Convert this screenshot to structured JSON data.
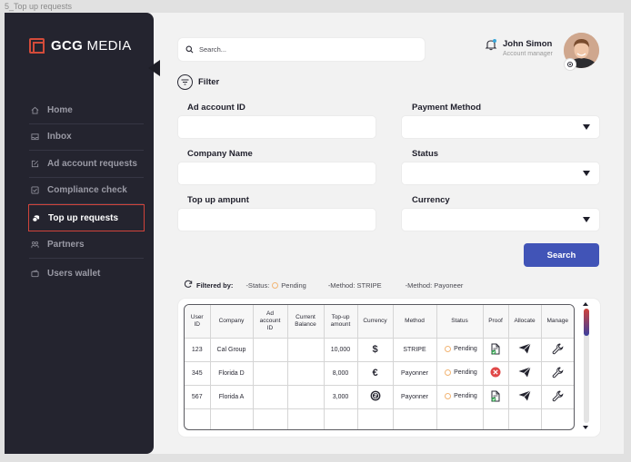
{
  "frame_label": "5_Top up requests",
  "brand": {
    "bold": "GCG",
    "rest": " MEDIA"
  },
  "sidebar": {
    "items": [
      {
        "label": "Home",
        "icon": "home-icon",
        "active": false
      },
      {
        "label": "Inbox",
        "icon": "inbox-icon",
        "active": false
      },
      {
        "label": "Ad account requests",
        "icon": "edit-icon",
        "active": false
      },
      {
        "label": "Compliance check",
        "icon": "checkbox-icon",
        "active": false
      },
      {
        "label": "Top up requests",
        "icon": "coins-icon",
        "active": true
      },
      {
        "label": "Partners",
        "icon": "partners-icon",
        "active": false
      },
      {
        "label": "Users wallet",
        "icon": "wallet-icon",
        "active": false
      }
    ]
  },
  "search": {
    "placeholder": "Search..."
  },
  "user": {
    "name": "John Simon",
    "role": "Account manager"
  },
  "filter": {
    "title": "Filter",
    "fields": {
      "ad_account_id": {
        "label": "Ad account ID",
        "value": ""
      },
      "payment_method": {
        "label": "Payment Method",
        "value": ""
      },
      "company_name": {
        "label": "Company Name",
        "value": ""
      },
      "status": {
        "label": "Status",
        "value": ""
      },
      "top_up_amount": {
        "label": "Top up ampunt",
        "value": ""
      },
      "currency": {
        "label": "Currency",
        "value": ""
      }
    },
    "search_button": "Search"
  },
  "filtered_by": {
    "label": "Filtered by:",
    "status_prefix": "-Status:",
    "status_value": "Pending",
    "method1": "-Method: STRIPE",
    "method2": "-Method: Payoneer"
  },
  "table": {
    "headers": {
      "user_id": [
        "User",
        "ID"
      ],
      "company": "Company",
      "ad_account_id": [
        "Ad",
        "account",
        "ID"
      ],
      "current_balance": [
        "Current",
        "Balance"
      ],
      "top_up_amount": [
        "Top-up",
        "amount"
      ],
      "currency": "Currency",
      "method": "Method",
      "status": "Status",
      "proof": "Proof",
      "allocate": "Allocate",
      "manage": "Manage"
    },
    "rows": [
      {
        "user_id": "123",
        "company": "Cal Group",
        "ad_account_id": "",
        "current_balance": "",
        "top_up_amount": "10,000",
        "currency": "$",
        "method": "STRIPE",
        "status": "Pending",
        "proof": "document-check-icon"
      },
      {
        "user_id": "345",
        "company": "Florida D",
        "ad_account_id": "",
        "current_balance": "",
        "top_up_amount": "8,000",
        "currency": "€",
        "method": "Payonner",
        "status": "Pending",
        "proof": "x-circle-icon"
      },
      {
        "user_id": "567",
        "company": "Florida A",
        "ad_account_id": "",
        "current_balance": "",
        "top_up_amount": "3,000",
        "currency": "coin",
        "method": "Payonner",
        "status": "Pending",
        "proof": "document-check-icon"
      }
    ]
  },
  "colors": {
    "sidebar_bg": "#24242f",
    "accent_red": "#d0433a",
    "primary_button": "#4154b7",
    "pending_dot": "#f2b574",
    "reject_red": "#e04848",
    "proof_green": "#3aa655"
  }
}
